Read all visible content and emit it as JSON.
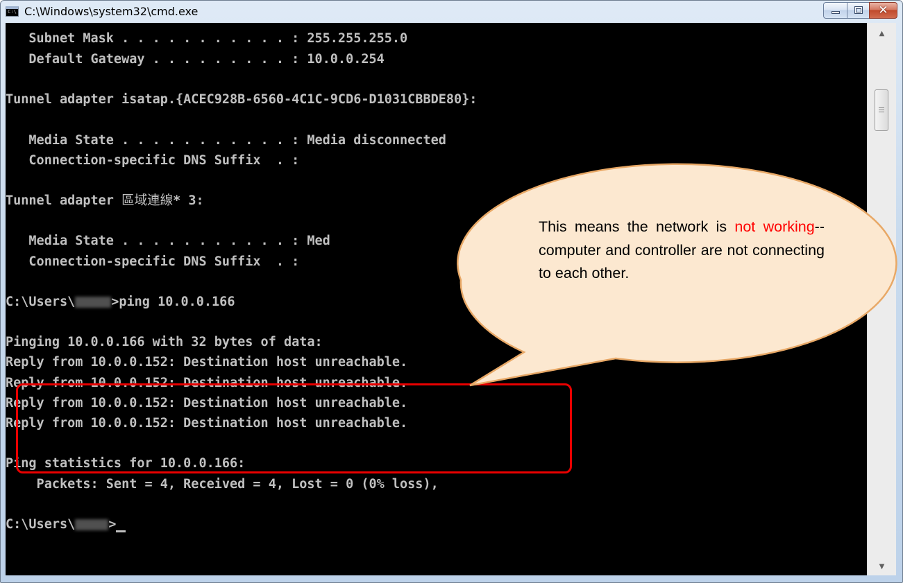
{
  "window": {
    "title": "C:\\Windows\\system32\\cmd.exe",
    "icon": "cmd-window-icon",
    "icon_text": "C:\\"
  },
  "console": {
    "lines": [
      "   Subnet Mask . . . . . . . . . . . : 255.255.255.0",
      "   Default Gateway . . . . . . . . . : 10.0.0.254",
      "Tunnel adapter isatap.{ACEC928B-6560-4C1C-9CD6-D1031CBBDE80}:",
      "   Media State . . . . . . . . . . . : Media disconnected",
      "   Connection-specific DNS Suffix  . :",
      "Tunnel adapter ",
      "   Media State . . . . . . . . . . . : Med",
      "   Connection-specific DNS Suffix  . :",
      "C:\\Users\\",
      "Pinging 10.0.0.166 with 32 bytes of data:",
      "Reply from 10.0.0.152: Destination host unreachable.",
      "Reply from 10.0.0.152: Destination host unreachable.",
      "Reply from 10.0.0.152: Destination host unreachable.",
      "Reply from 10.0.0.152: Destination host unreachable.",
      "Ping statistics for 10.0.0.166:",
      "    Packets: Sent = 4, Received = 4, Lost = 0 (0% loss),",
      "C:\\Users\\"
    ],
    "adapter_cjk_name": "區域連線",
    "adapter_suffix": "* 3:",
    "ping_command": ">ping 10.0.0.166",
    "prompt_end": ">"
  },
  "callout": {
    "text_before": "This means the network is ",
    "highlight_text": "not working",
    "text_after": "--computer and controller are not connecting to each other.",
    "highlight_color": "#ff0000",
    "fill_color": "#fce8d0",
    "border_color": "#e8a866"
  },
  "annotation": {
    "box_color": "#ea0000"
  }
}
